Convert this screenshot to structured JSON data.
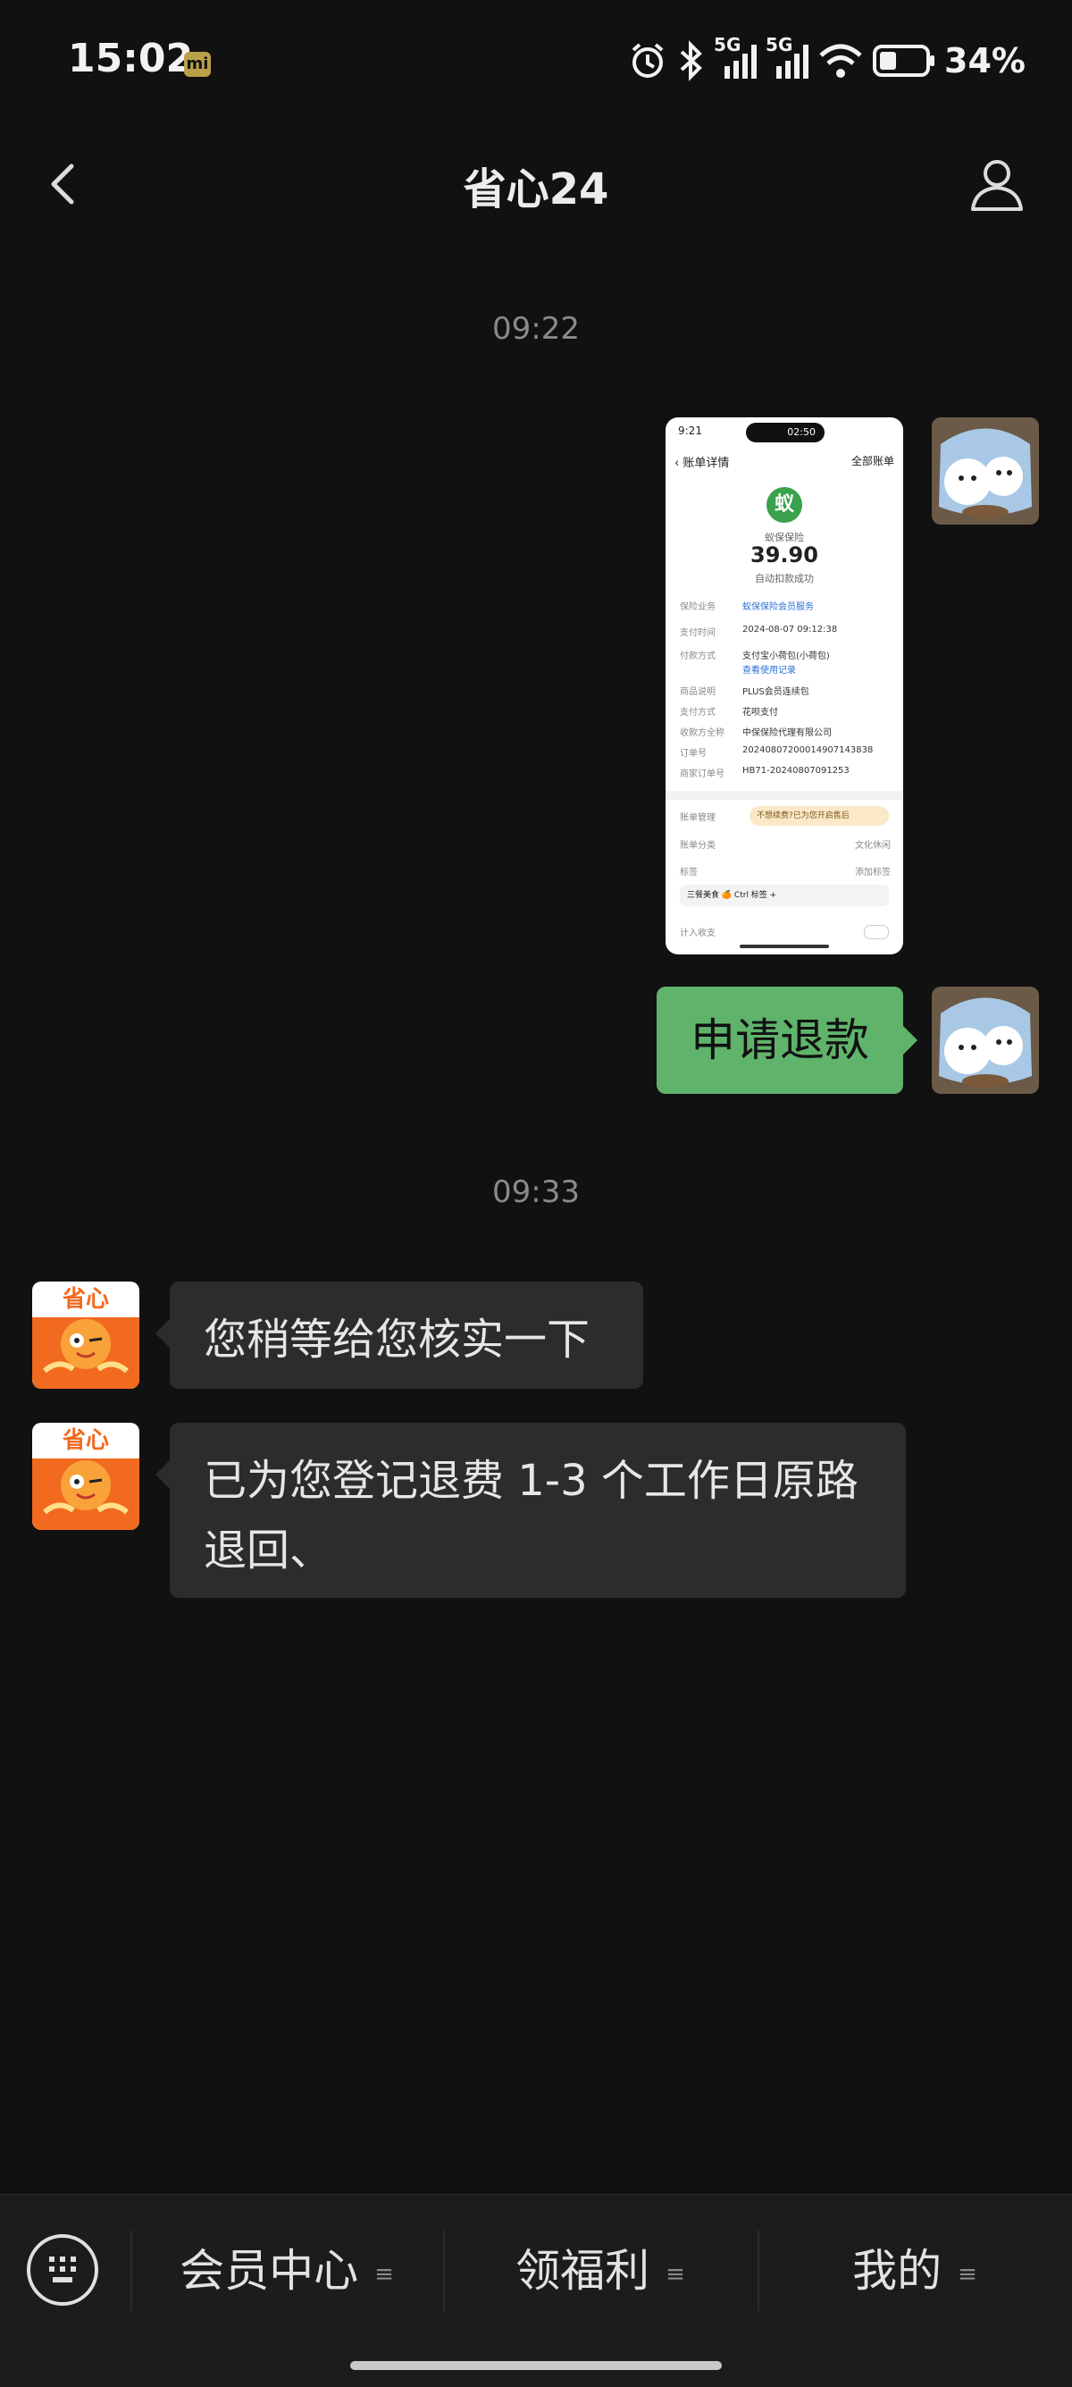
{
  "status_bar": {
    "time": "15:02",
    "battery_percent": "34%",
    "network_1": "5G",
    "network_2": "5G"
  },
  "header": {
    "title": "省心24"
  },
  "chat": {
    "messages": [
      {
        "type": "timestamp",
        "text": "09:22"
      },
      {
        "type": "image",
        "direction": "outgoing",
        "screenshot": {
          "status_time": "9:21",
          "call_time": "02:50",
          "nav_title": "账单详情",
          "nav_right": "全部账单",
          "merchant": "蚁保保险",
          "amount": "39.90",
          "amount_status": "自动扣款成功",
          "rows": [
            {
              "label": "保险业务",
              "value": "蚁保保险会员服务",
              "link": true
            },
            {
              "label": "支付时间",
              "value": "2024-08-07 09:12:38",
              "link": false
            },
            {
              "label": "付款方式",
              "value": "支付宝小荷包(小荷包)",
              "link": false
            },
            {
              "label": "",
              "value": "查看使用记录",
              "link": true
            },
            {
              "label": "商品说明",
              "value": "PLUS会员连续包",
              "link": false
            },
            {
              "label": "支付方式",
              "value": "花呗支付",
              "link": false
            },
            {
              "label": "收款方全称",
              "value": "中保保险代理有限公司",
              "link": false
            },
            {
              "label": "订单号",
              "value": "20240807200014907143838",
              "link": false
            },
            {
              "label": "商家订单号",
              "value": "HB71-20240807091253",
              "link": false
            }
          ],
          "bill_service_label": "账单管理",
          "bill_service_pill": "不想续费?已为您开启售后",
          "category_label": "账单分类",
          "category_value": "文化休闲",
          "tag_label": "标签",
          "tag_value": "添加标签",
          "tag_chip": "三餐美食  🍊 Ctrl 标签 +",
          "exclude_label": "计入收支"
        }
      },
      {
        "type": "text",
        "direction": "outgoing",
        "text": "申请退款"
      },
      {
        "type": "timestamp",
        "text": "09:33"
      },
      {
        "type": "text",
        "direction": "incoming",
        "text": "您稍等给您核实一下"
      },
      {
        "type": "text",
        "direction": "incoming",
        "text": "已为您登记退费 1-3 个工作日原路退回、"
      }
    ]
  },
  "contact_avatar": {
    "logo_text": "省心"
  },
  "bottom_menu": {
    "items": [
      {
        "label": "会员中心"
      },
      {
        "label": "领福利"
      },
      {
        "label": "我的"
      }
    ]
  },
  "colors": {
    "background": "#111111",
    "outgoing_bubble": "#5fb36b",
    "incoming_bubble": "#2c2c2c",
    "timestamp": "#8a8a8a",
    "bottom_bar": "#1c1c1c"
  },
  "icons": [
    "alarm-icon",
    "bluetooth-icon",
    "signal-icon",
    "wifi-icon",
    "battery-icon",
    "back-arrow-icon",
    "profile-icon",
    "keyboard-icon",
    "menu-lines-icon"
  ]
}
